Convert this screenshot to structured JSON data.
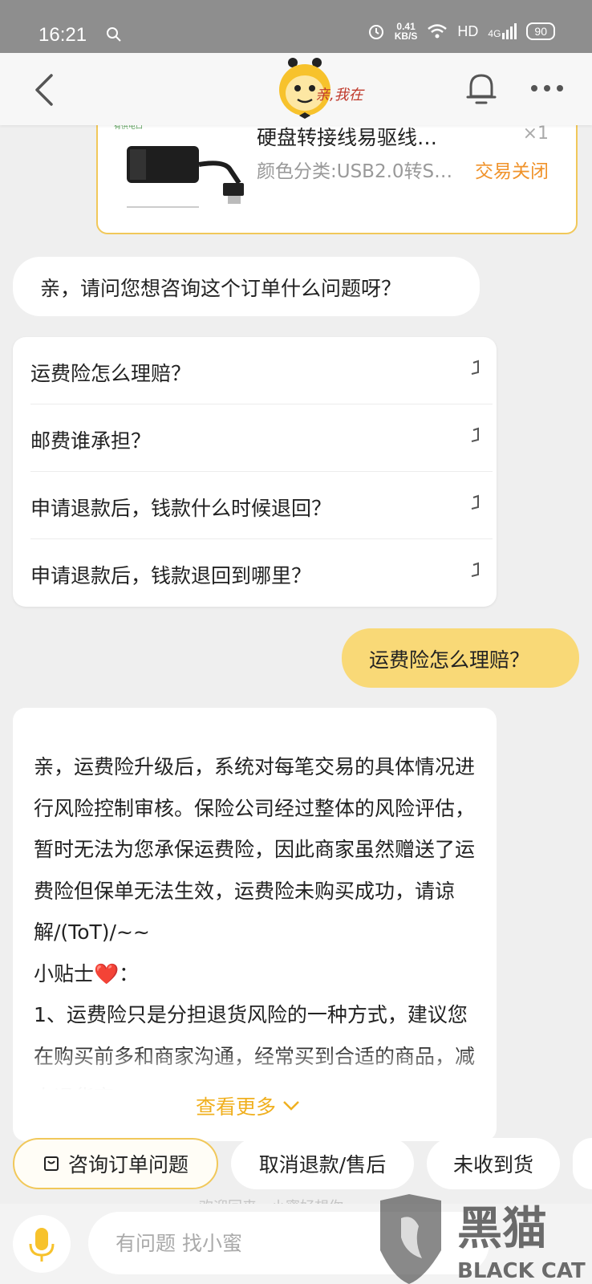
{
  "status_bar": {
    "time": "16:21",
    "net_speed_value": "0.41",
    "net_speed_unit": "KB/S",
    "hd": "HD",
    "signal": "4G",
    "battery": "90"
  },
  "header": {
    "logo_text": "亲,我在"
  },
  "product": {
    "thumbnail_caption": "有供电口",
    "title": "硬盘转接线易驱线…",
    "quantity": "×1",
    "spec": "颜色分类:USB2.0转S…",
    "status": "交易关闭"
  },
  "messages": {
    "prompt": "亲，请问您想咨询这个订单什么问题呀？",
    "faq": [
      "运费险怎么理赔？",
      "邮费谁承担？",
      "申请退款后，钱款什么时候退回？",
      "申请退款后，钱款退回到哪里？"
    ],
    "user_message": "运费险怎么理赔？",
    "answer": "亲，运费险升级后，系统对每笔交易的具体情况进行风险控制审核。保险公司经过整体的风险评估，暂时无法为您承保运费险，因此商家虽然赠送了运费险但保单无法生效，运费险未购买成功，请谅解/(ToT)/~~\n小贴士❤️：\n1、运费险只是分担退货风险的一种方式，建议您在购买前多和商家沟通，经常买到合适的商品，减少退货率",
    "see_more": "查看更多"
  },
  "quick_replies": [
    "咨询订单问题",
    "取消退款/售后",
    "未收到货"
  ],
  "footer_hint": "欢迎回来，小蜜好想你",
  "input": {
    "placeholder": "有问题 找小蜜"
  },
  "watermark": {
    "text_cn": "黑猫",
    "text_en": "BLACK CAT"
  },
  "colors": {
    "accent": "#f1c85a",
    "user_bubble": "#f9d977",
    "status_orange": "#f0932b",
    "see_more": "#f0b020"
  }
}
